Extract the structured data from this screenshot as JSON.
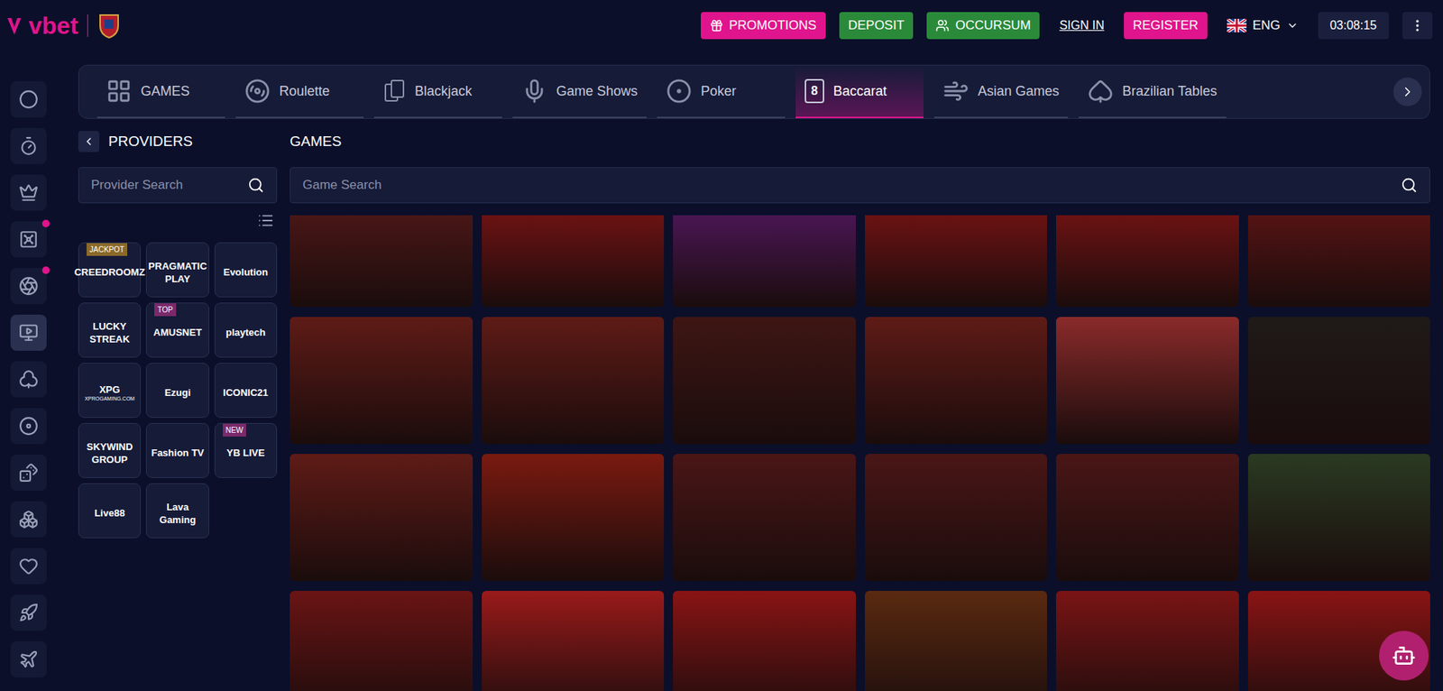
{
  "header": {
    "logo": "vbet",
    "buttons": [
      {
        "label": "PROMOTIONS",
        "kind": "pink"
      },
      {
        "label": "DEPOSIT",
        "kind": "green"
      },
      {
        "label": "OCCURSUM",
        "kind": "green"
      },
      {
        "label": "SIGN IN",
        "kind": "link"
      },
      {
        "label": "REGISTER",
        "kind": "pink"
      }
    ],
    "language": "ENG",
    "time": "03:08:15"
  },
  "rail": [
    {
      "selected": false,
      "dot": false
    },
    {
      "selected": false,
      "dot": false
    },
    {
      "selected": false,
      "dot": false
    },
    {
      "selected": false,
      "dot": true
    },
    {
      "selected": false,
      "dot": true
    },
    {
      "selected": true,
      "dot": false
    },
    {
      "selected": false,
      "dot": false
    },
    {
      "selected": false,
      "dot": false
    },
    {
      "selected": false,
      "dot": false
    },
    {
      "selected": false,
      "dot": false
    },
    {
      "selected": false,
      "dot": false
    },
    {
      "selected": false,
      "dot": false
    },
    {
      "selected": false,
      "dot": false
    }
  ],
  "categories": [
    {
      "label": "GAMES",
      "selected": false
    },
    {
      "label": "Roulette",
      "selected": false
    },
    {
      "label": "Blackjack",
      "selected": false
    },
    {
      "label": "Game Shows",
      "selected": false
    },
    {
      "label": "Poker",
      "selected": false
    },
    {
      "label": "Baccarat",
      "selected": true,
      "icon_text": "8"
    },
    {
      "label": "Asian Games",
      "selected": false
    },
    {
      "label": "Brazilian Tables",
      "selected": false
    }
  ],
  "providers": {
    "title": "PROVIDERS",
    "search_placeholder": "Provider Search",
    "items": [
      {
        "name": "CREEDROOMZ",
        "badge": "JACKPOT"
      },
      {
        "name": "PRAGMATIC PLAY",
        "badge": ""
      },
      {
        "name": "Evolution",
        "badge": ""
      },
      {
        "name": "LUCKY STREAK",
        "badge": ""
      },
      {
        "name": "AMUSNET",
        "badge": "TOP"
      },
      {
        "name": "playtech",
        "badge": ""
      },
      {
        "name": "XPG",
        "sub": "XPROGAMING.COM",
        "badge": ""
      },
      {
        "name": "Ezugi",
        "badge": ""
      },
      {
        "name": "ICONIC21",
        "badge": ""
      },
      {
        "name": "SKYWIND GROUP",
        "badge": ""
      },
      {
        "name": "Fashion TV",
        "badge": ""
      },
      {
        "name": "YB LIVE",
        "badge": "NEW"
      },
      {
        "name": "Live88",
        "badge": ""
      },
      {
        "name": "Lava Gaming",
        "badge": ""
      }
    ]
  },
  "games": {
    "title": "GAMES",
    "search_placeholder": "Game Search",
    "tiles": [
      {
        "color": "#5a1a1a"
      },
      {
        "color": "#8a1414"
      },
      {
        "color": "#5b1a6e"
      },
      {
        "color": "#8a1414"
      },
      {
        "color": "#8a1414"
      },
      {
        "color": "#6a1616"
      },
      {
        "color": "#5e1b16"
      },
      {
        "color": "#5e1b16"
      },
      {
        "color": "#3e1614"
      },
      {
        "color": "#5e1b16"
      },
      {
        "color": "#8a2a2a"
      },
      {
        "color": "#1f1a18"
      },
      {
        "color": "#5e1b16"
      },
      {
        "color": "#7a1a10"
      },
      {
        "color": "#4a1616"
      },
      {
        "color": "#4a1616"
      },
      {
        "color": "#4a1616"
      },
      {
        "color": "#2a3a22"
      },
      {
        "color": "#6a1414"
      },
      {
        "color": "#9a1a1a"
      },
      {
        "color": "#8a1414"
      },
      {
        "color": "#5a2a10"
      },
      {
        "color": "#7a1414"
      },
      {
        "color": "#8a1414"
      }
    ]
  }
}
